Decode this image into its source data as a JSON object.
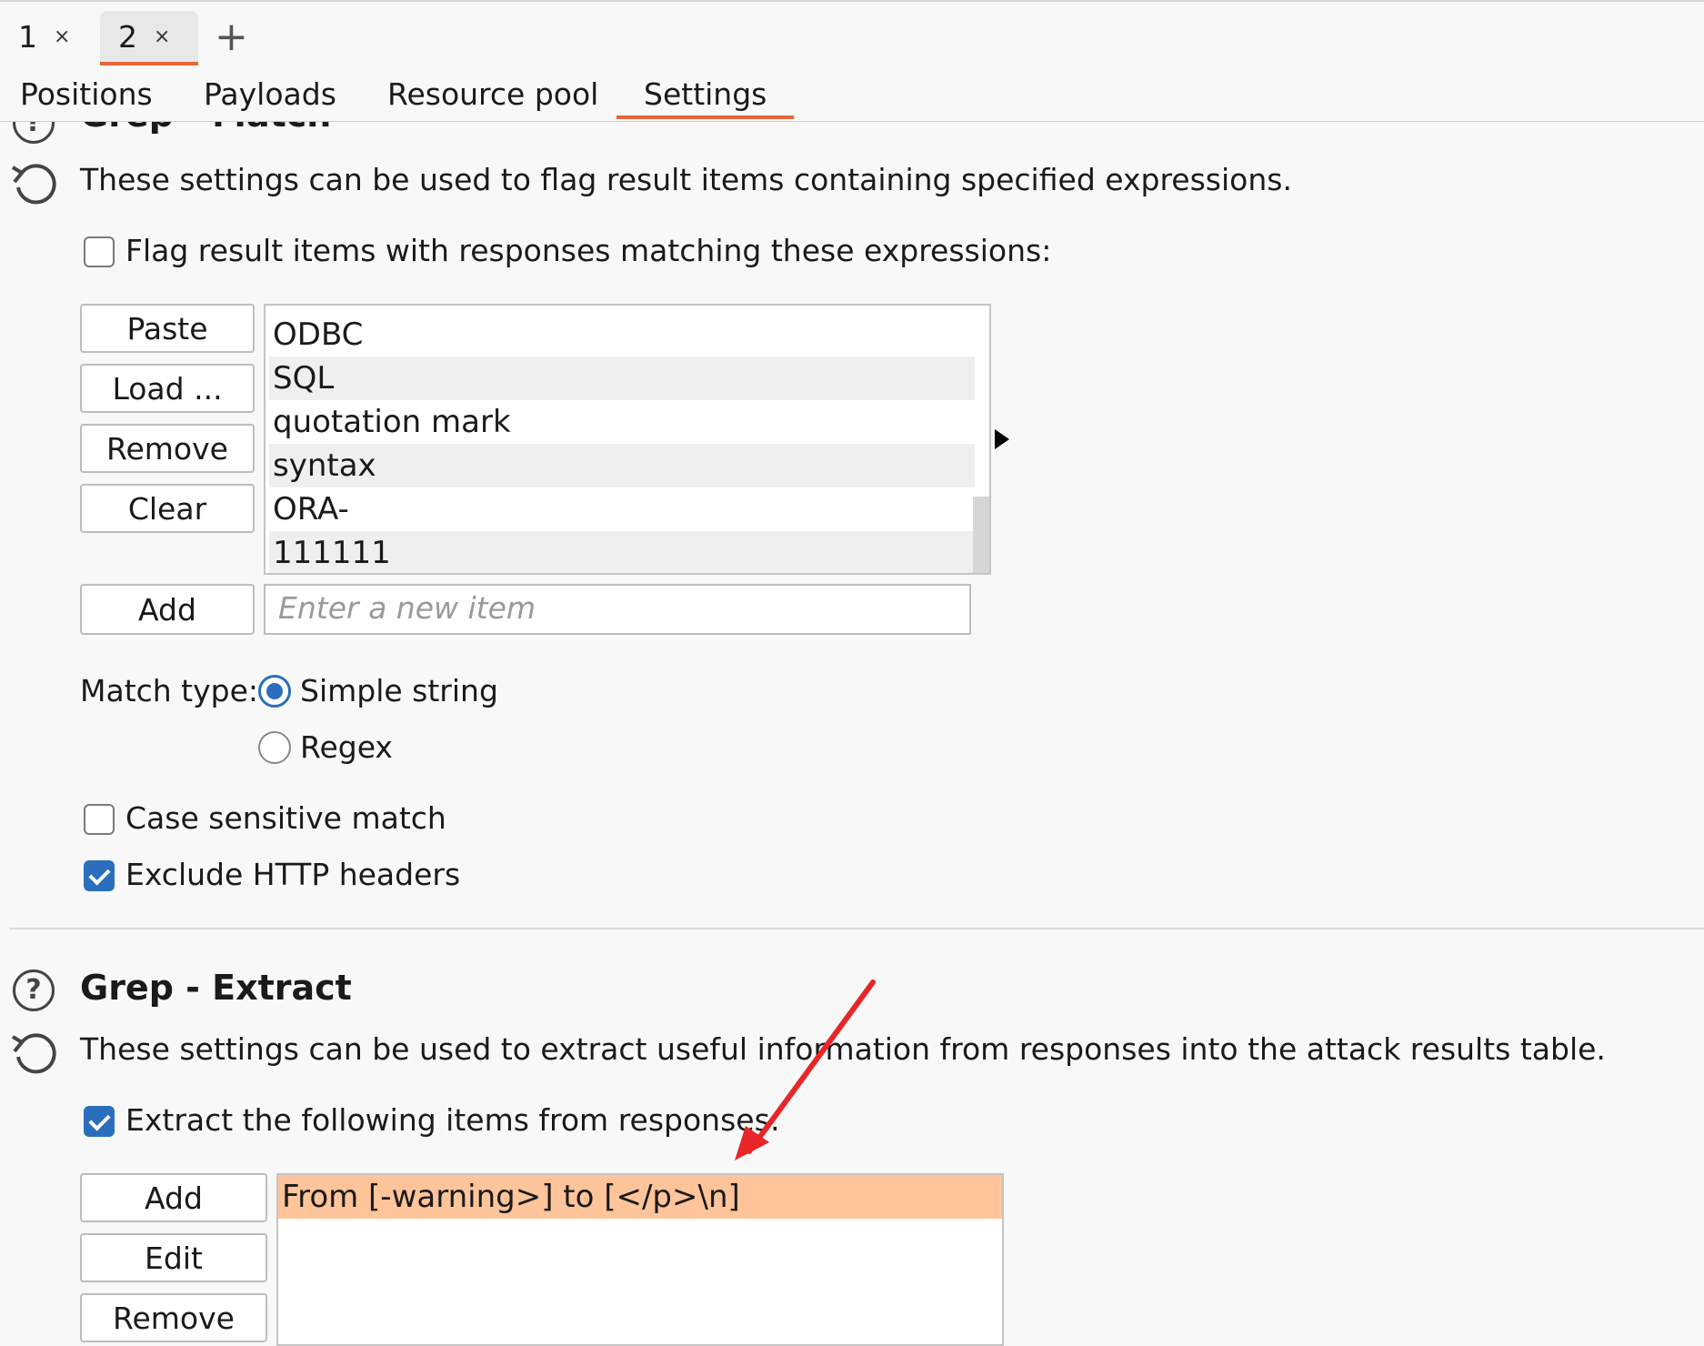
{
  "window_tabs": [
    {
      "label": "1",
      "close": "×"
    },
    {
      "label": "2",
      "close": "×",
      "active": true
    }
  ],
  "add_tab_symbol": "+",
  "sub_tabs": [
    "Positions",
    "Payloads",
    "Resource pool",
    "Settings"
  ],
  "active_sub_tab": "Settings",
  "grep_match": {
    "title": "Grep - Match",
    "description": "These settings can be used to flag result items containing specified expressions.",
    "flag_label": "Flag result items with responses matching these expressions:",
    "flag_checked": false,
    "buttons": {
      "paste": "Paste",
      "load": "Load ...",
      "remove": "Remove",
      "clear": "Clear",
      "add": "Add"
    },
    "items": [
      "ODBC",
      "SQL",
      "quotation mark",
      "syntax",
      "ORA-",
      "111111"
    ],
    "new_item_placeholder": "Enter a new item",
    "match_type_label": "Match type:",
    "match_types": [
      "Simple string",
      "Regex"
    ],
    "selected_match_type": "Simple string",
    "case_sensitive_label": "Case sensitive match",
    "case_sensitive_checked": false,
    "exclude_headers_label": "Exclude HTTP headers",
    "exclude_headers_checked": true
  },
  "grep_extract": {
    "title": "Grep - Extract",
    "description": "These settings can be used to extract useful information from responses into the attack results table.",
    "extract_label": "Extract the following items from responses:",
    "extract_checked": true,
    "buttons": {
      "add": "Add",
      "edit": "Edit",
      "remove": "Remove"
    },
    "items": [
      "From [-warning>] to [</p>\\n]"
    ]
  },
  "colors": {
    "accent": "#e8663a",
    "checkbox": "#2a6ebd",
    "selected_row": "#ffc499",
    "annotation_arrow": "#e8262a"
  }
}
